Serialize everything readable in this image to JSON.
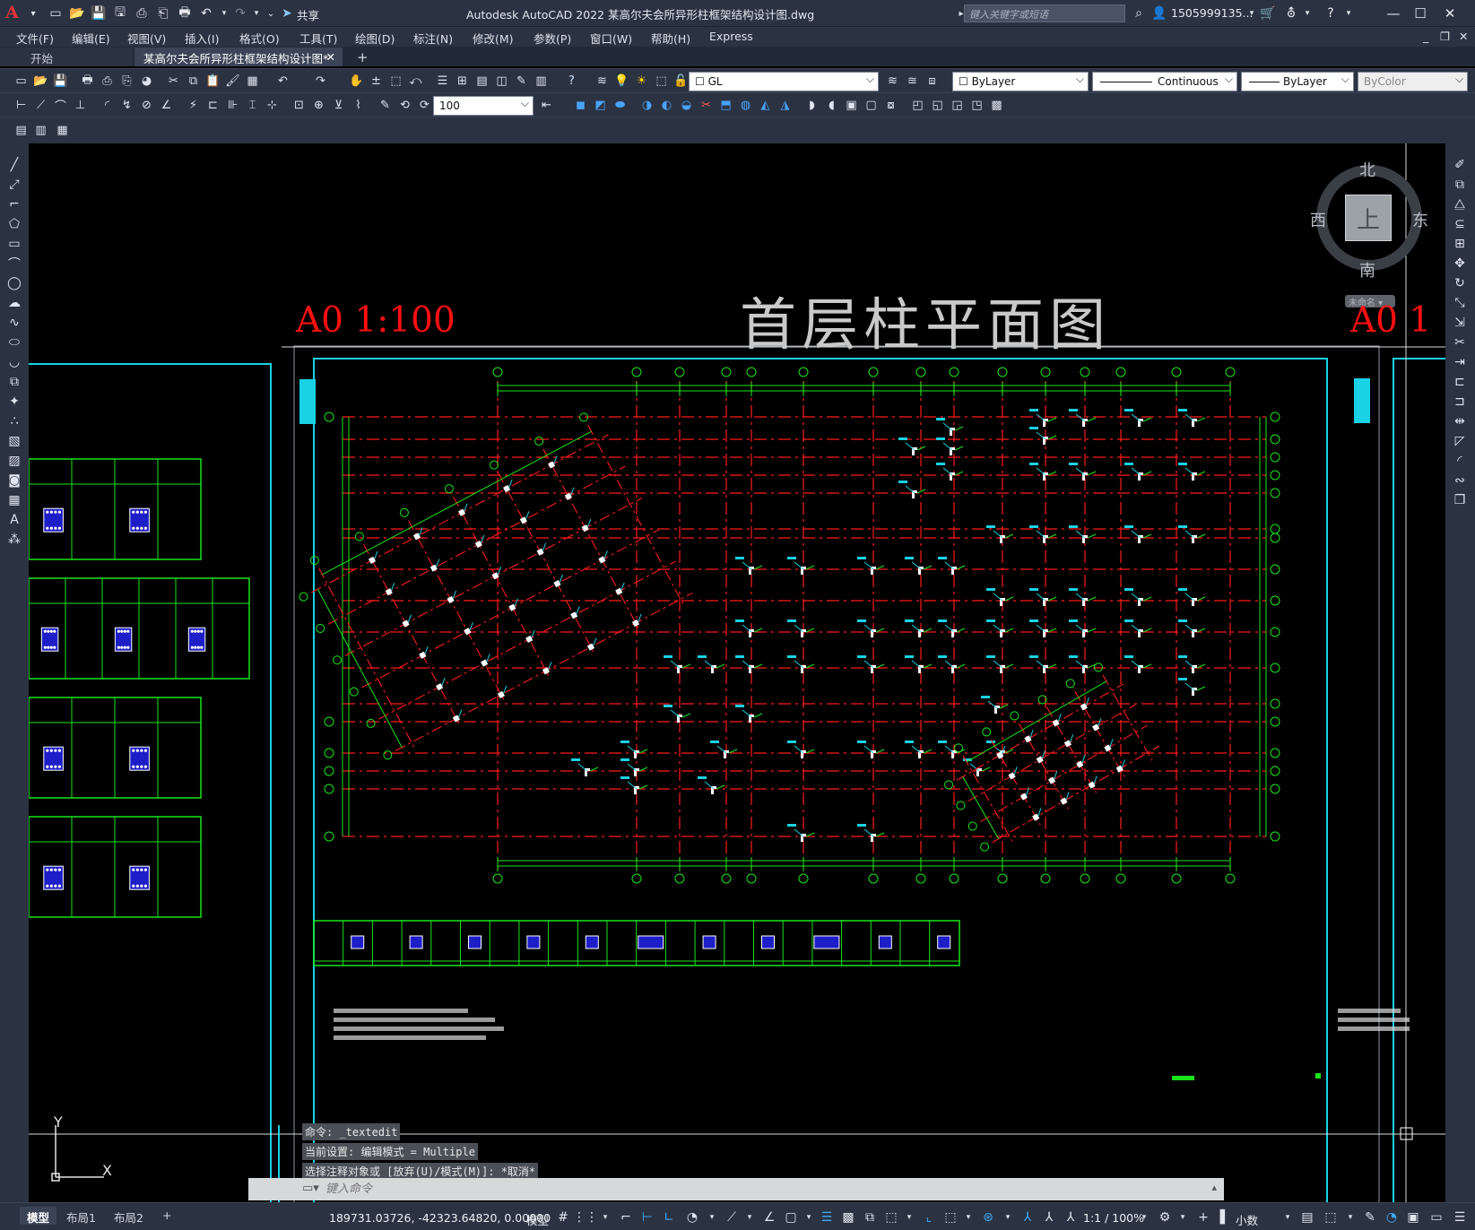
{
  "app": {
    "logo": "A",
    "title": "Autodesk AutoCAD 2022    某高尔夫会所异形柱框架结构设计图.dwg",
    "share_label": "共享",
    "search_placeholder": "键入关键字或短语",
    "user": "1505999135..."
  },
  "menu": [
    "文件(F)",
    "编辑(E)",
    "视图(V)",
    "插入(I)",
    "格式(O)",
    "工具(T)",
    "绘图(D)",
    "标注(N)",
    "修改(M)",
    "参数(P)",
    "窗口(W)",
    "帮助(H)",
    "Express"
  ],
  "tabs": {
    "start": "开始",
    "active": "某高尔夫会所异形柱框架结构设计图*",
    "close": "✕",
    "add": "+"
  },
  "properties": {
    "layer": "GL",
    "color": "ByLayer",
    "linetype": "Continuous",
    "lineweight": "ByLayer",
    "plotstyle": "ByColor",
    "dim_scale": "100"
  },
  "viewcube": {
    "north": "北",
    "south": "南",
    "east": "东",
    "west": "西",
    "top": "上",
    "ucs_menu": "未命名 ▾"
  },
  "drawing": {
    "scale_left": "A0    1:100",
    "scale_right": "A0   1",
    "title": "首层柱平面图"
  },
  "command": {
    "history": [
      "命令: _textedit",
      "当前设置: 编辑模式 = Multiple",
      "选择注释对象或 [放弃(U)/模式(M)]: *取消*"
    ],
    "input_placeholder": "键入命令"
  },
  "ucs": {
    "x": "X",
    "y": "Y"
  },
  "status": {
    "layouts": [
      "模型",
      "布局1",
      "布局2"
    ],
    "add_layout": "+",
    "coordinates": "189731.03726, -42323.64820, 0.00000",
    "space": "模型",
    "annotation_scale": "1:1 / 100%",
    "units": "小数"
  },
  "colors": {
    "titlebar": "#2b3342",
    "grid_green": "#19e619",
    "axis_red": "#ff1a1a",
    "frame_cyan": "#19d2e6",
    "column_blue": "#1e1ec8",
    "selected_blue": "#3fa9f5"
  }
}
